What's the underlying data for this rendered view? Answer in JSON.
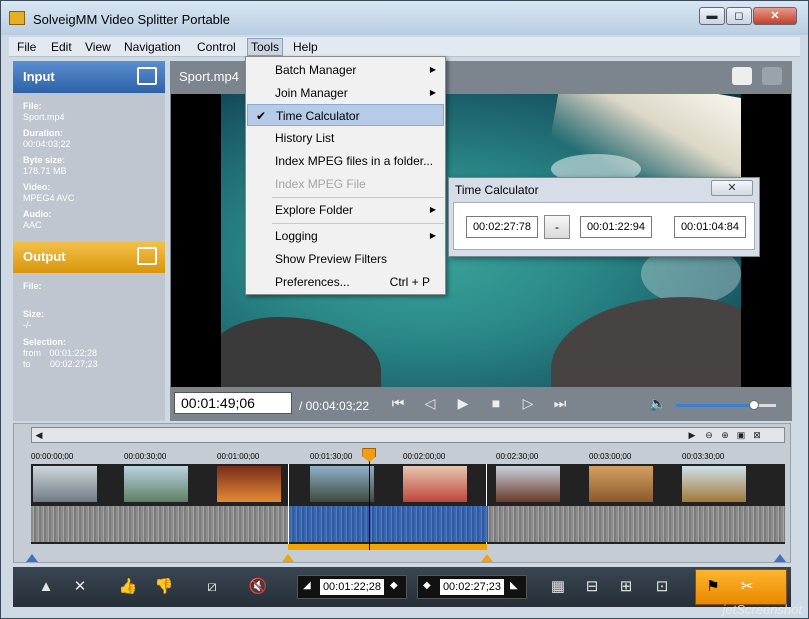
{
  "window": {
    "title": "SolveigMM Video Splitter Portable",
    "min": "▬",
    "max": "◻",
    "close": "✕"
  },
  "menubar": {
    "items": [
      "File",
      "Edit",
      "View",
      "Navigation",
      "Control",
      "Tools",
      "Help"
    ]
  },
  "input_panel": {
    "title": "Input",
    "file_label": "File:",
    "file_value": "Sport.mp4",
    "duration_label": "Duration:",
    "duration_value": "00:04:03;22",
    "bytesize_label": "Byte size:",
    "bytesize_value": "178.71 MB",
    "video_label": "Video:",
    "video_value": "MPEG4 AVC",
    "audio_label": "Audio:",
    "audio_value": "AAC"
  },
  "output_panel": {
    "title": "Output",
    "file_label": "File:",
    "size_label": "Size:",
    "size_value": "-/-",
    "selection_label": "Selection:",
    "from_label": "from",
    "from_value": "00:01:22;28",
    "to_label": "to",
    "to_value": "00:02:27;23"
  },
  "video": {
    "title": "Sport.mp4",
    "current_time": "00:01:49;06",
    "duration": "/ 00:04:03;22",
    "volume": 0.78
  },
  "tools_menu": {
    "items": [
      {
        "label": "Batch Manager",
        "submenu": true
      },
      {
        "label": "Join Manager",
        "submenu": true
      },
      {
        "label": "Time Calculator",
        "checked": true,
        "highlighted": true
      },
      {
        "label": "History List"
      },
      {
        "label": "Index MPEG files in a folder..."
      },
      {
        "label": "Index MPEG File",
        "disabled": true
      },
      {
        "label": "Explore Folder",
        "submenu": true
      },
      {
        "label": "Logging",
        "submenu": true
      },
      {
        "label": "Show Preview Filters"
      },
      {
        "label": "Preferences...",
        "shortcut": "Ctrl + P"
      }
    ],
    "check_glyph": "✔",
    "arrow_glyph": "▶"
  },
  "time_calculator": {
    "title": "Time Calculator",
    "close": "✕",
    "value_a": "00:02:27:78",
    "op": "-",
    "value_b": "00:01:22:94",
    "result": "00:01:04:84"
  },
  "timeline": {
    "ticks": [
      "00:00:00;00",
      "00:00:30;00",
      "00:01:00;00",
      "00:01:30;00",
      "00:02:00;00",
      "00:02:30;00",
      "00:03:00;00",
      "00:03:30;00"
    ],
    "selection_start": 0.3408,
    "selection_end": 0.6053,
    "cursor": 0.4487
  },
  "bottombar": {
    "start_time": "00:01:22;28",
    "end_time": "00:02:27;23"
  },
  "colors": {
    "input_header": "#2e62a8",
    "output_header": "#d9960b",
    "selection": "#f0a500"
  },
  "watermark": "jetScreenshot"
}
